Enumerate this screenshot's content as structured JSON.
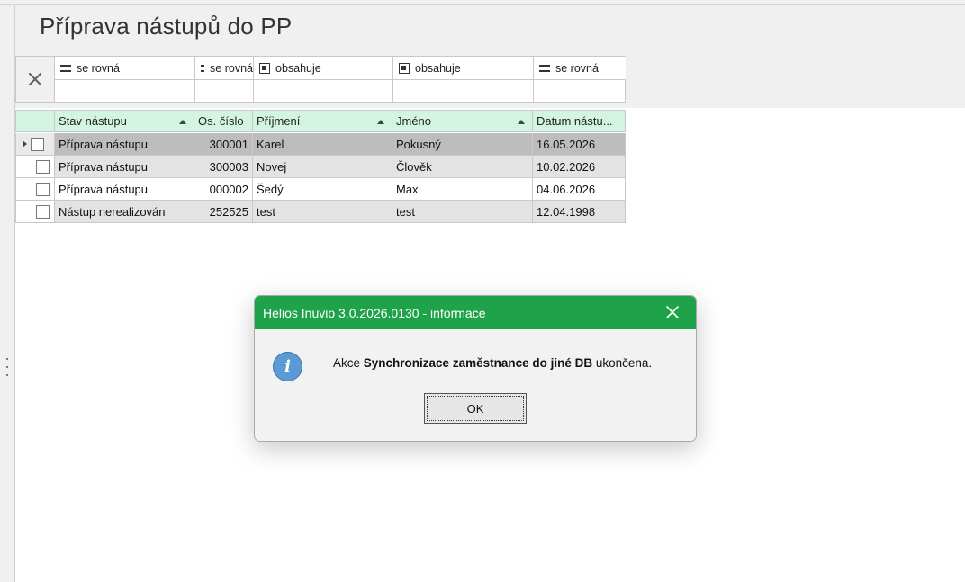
{
  "page": {
    "title": "Příprava nástupů do PP"
  },
  "filters": [
    {
      "operator": "se rovná",
      "icon": "equals-icon"
    },
    {
      "operator": "se rovná",
      "icon": "equals-icon"
    },
    {
      "operator": "obsahuje",
      "icon": "contains-icon"
    },
    {
      "operator": "obsahuje",
      "icon": "contains-icon"
    },
    {
      "operator": "se rovná",
      "icon": "equals-icon"
    }
  ],
  "grid": {
    "columns": [
      "Stav nástupu",
      "Os. číslo",
      "Příjmení",
      "Jméno",
      "Datum nástu..."
    ],
    "rows": [
      {
        "stav": "Příprava nástupu",
        "os_cislo": "300001",
        "prijmeni": "Karel",
        "jmeno": "Pokusný",
        "datum": "16.05.2026"
      },
      {
        "stav": "Příprava nástupu",
        "os_cislo": "300003",
        "prijmeni": "Novej",
        "jmeno": "Člověk",
        "datum": "10.02.2026"
      },
      {
        "stav": "Příprava nástupu",
        "os_cislo": "000002",
        "prijmeni": "Šedý",
        "jmeno": "Max",
        "datum": "04.06.2026"
      },
      {
        "stav": "Nástup nerealizován",
        "os_cislo": "252525",
        "prijmeni": "test",
        "jmeno": "test",
        "datum": "12.04.1998"
      }
    ]
  },
  "dialog": {
    "title": "Helios Inuvio 3.0.2026.0130 - informace",
    "message_prefix": "Akce",
    "message_bold": "Synchronizace zaměstnance do jiné DB",
    "message_suffix": "ukončena.",
    "ok_label": "OK"
  },
  "colors": {
    "header_green": "#d3f4e0",
    "dialog_title_green": "#1ea34a",
    "info_blue": "#5b9bd5",
    "selected_row": "#bdbdbd"
  }
}
